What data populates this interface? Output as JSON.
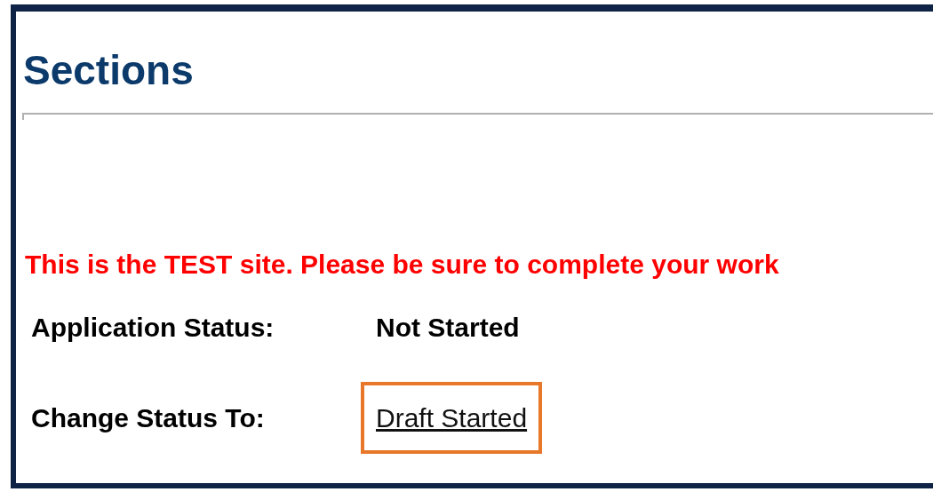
{
  "heading": "Sections",
  "notice": "This is the TEST site. Please be sure to complete your work",
  "fields": [
    {
      "label": "Application Status:",
      "value": "Not Started",
      "kind": "text"
    },
    {
      "label": "Change Status To:",
      "value": "Draft Started",
      "kind": "link",
      "highlighted": true
    }
  ]
}
